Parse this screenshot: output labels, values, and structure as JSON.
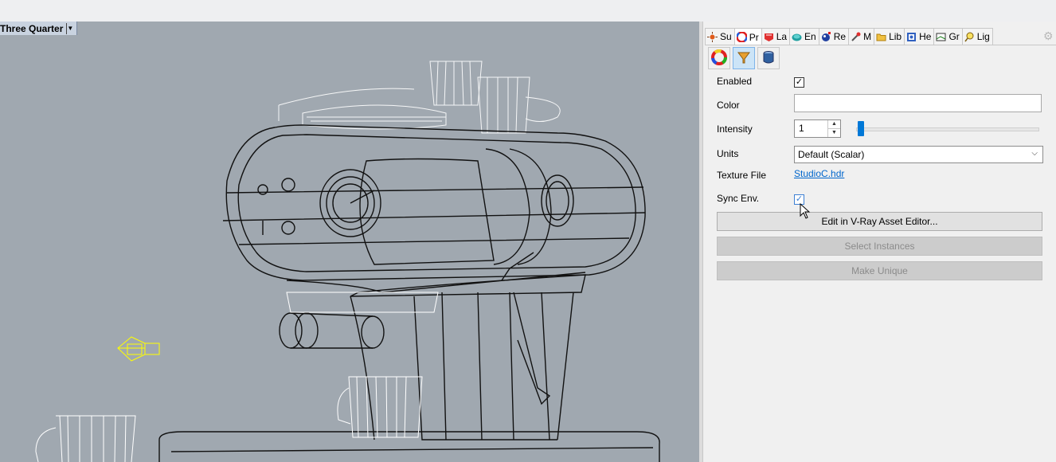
{
  "viewport": {
    "title": "Three Quarter",
    "background_color": "#a0a8b0"
  },
  "panel": {
    "tabs": [
      {
        "label": "Su",
        "icon": "sun-icon"
      },
      {
        "label": "Pr",
        "icon": "color-wheel-icon"
      },
      {
        "label": "La",
        "icon": "layers-icon"
      },
      {
        "label": "En",
        "icon": "environment-icon"
      },
      {
        "label": "Re",
        "icon": "render-icon"
      },
      {
        "label": "M",
        "icon": "material-icon"
      },
      {
        "label": "Lib",
        "icon": "folder-icon"
      },
      {
        "label": "He",
        "icon": "help-icon"
      },
      {
        "label": "Gr",
        "icon": "ground-plane-icon"
      },
      {
        "label": "Lig",
        "icon": "light-bulb-icon"
      }
    ],
    "subtabs": [
      "color-wheel-icon",
      "environment-funnel-icon",
      "cylinder-icon"
    ],
    "properties": {
      "enabled_label": "Enabled",
      "enabled_checked": true,
      "color_label": "Color",
      "color_value": "#ffffff",
      "intensity_label": "Intensity",
      "intensity_value": "1",
      "units_label": "Units",
      "units_value": "Default (Scalar)",
      "texture_label": "Texture File",
      "texture_value": "StudioC.hdr",
      "sync_label": "Sync Env.",
      "sync_checked": true
    },
    "buttons": {
      "edit": "Edit in V-Ray Asset Editor...",
      "select_instances": "Select Instances",
      "make_unique": "Make Unique"
    },
    "accent_color": "#0078d7"
  }
}
